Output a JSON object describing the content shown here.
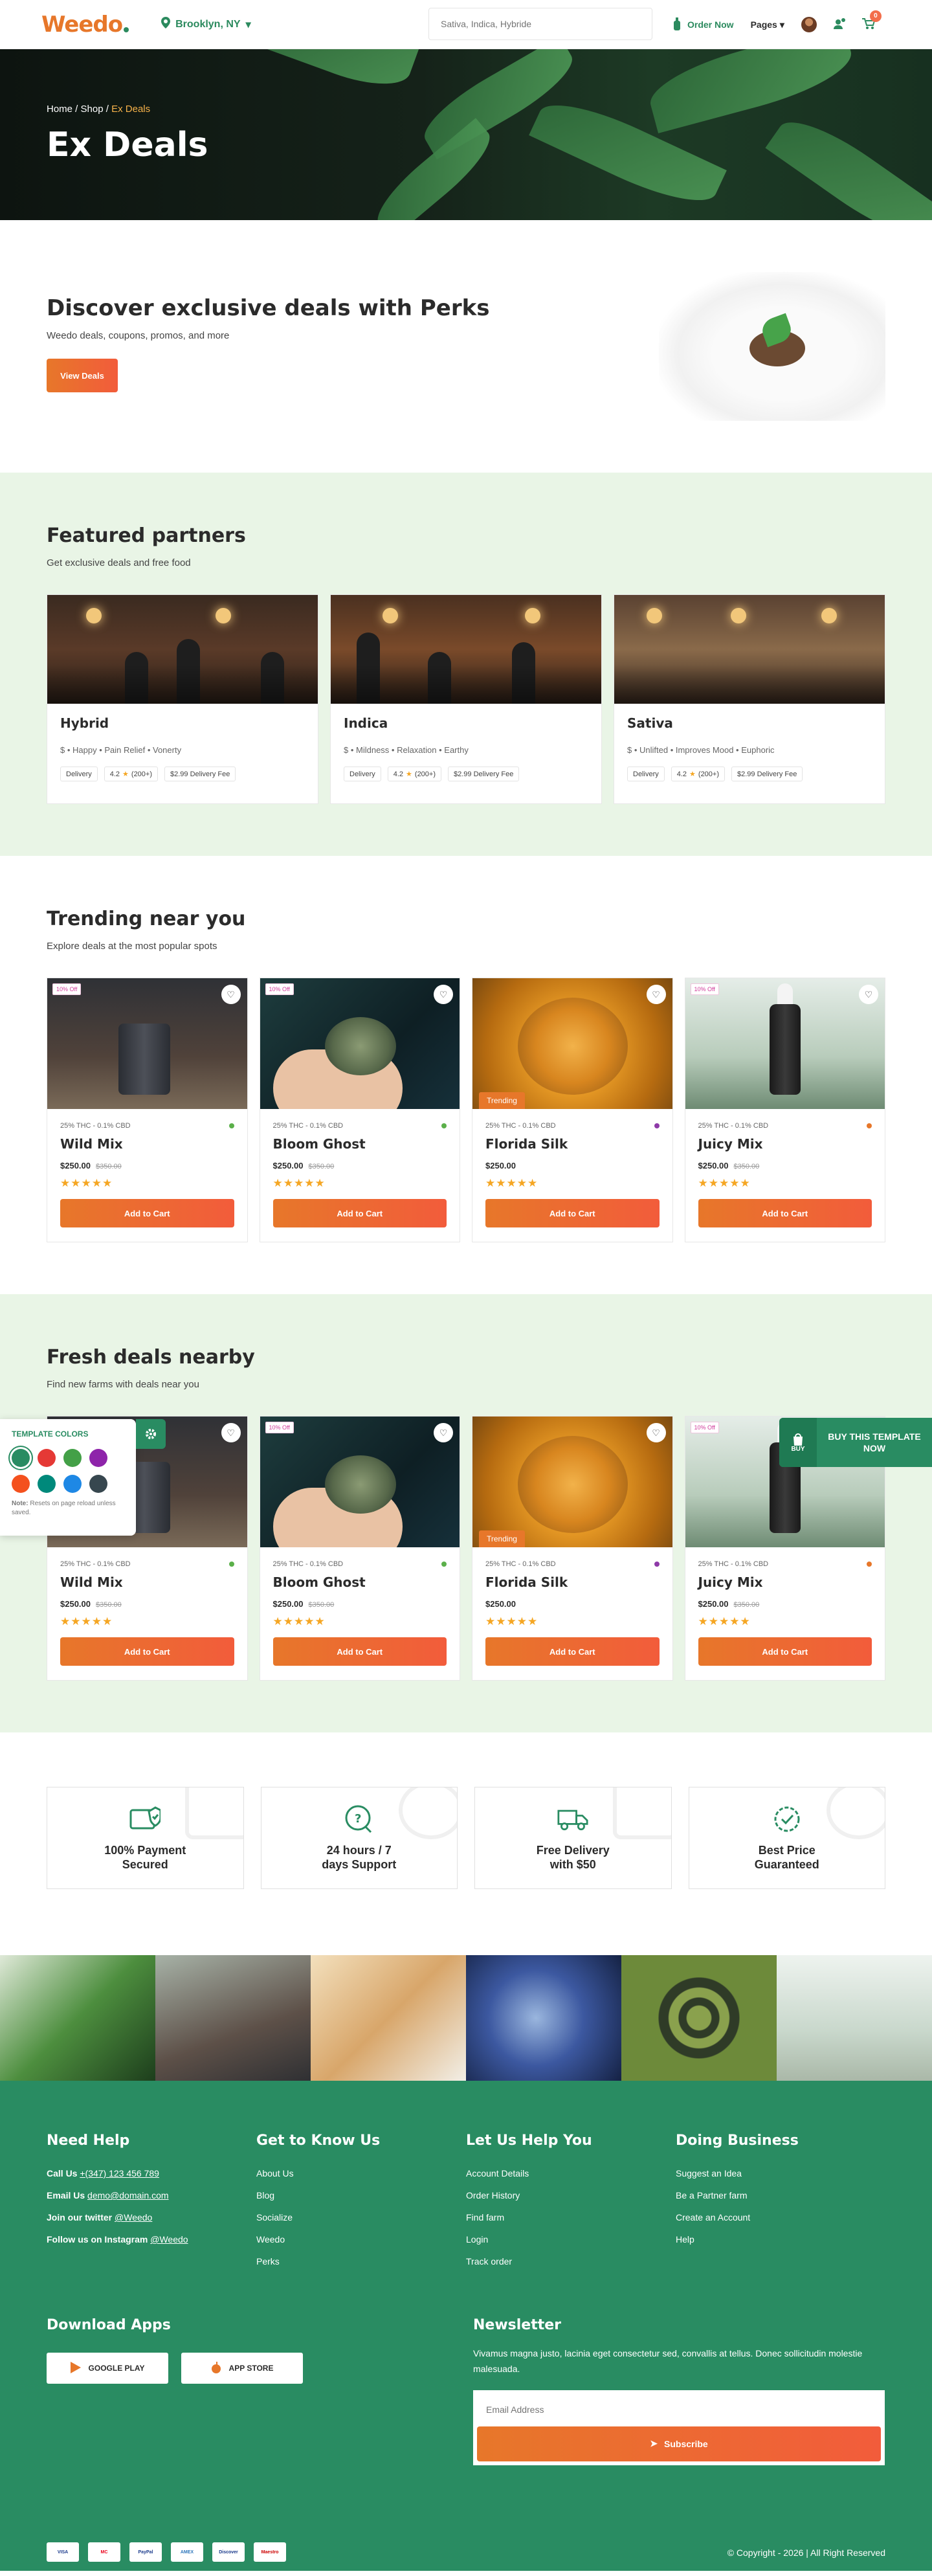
{
  "header": {
    "logo": "Weedo",
    "location": "Brooklyn, NY",
    "search_placeholder": "Sativa, Indica, Hybride",
    "order_now": "Order Now",
    "pages": "Pages",
    "cart_count": "0"
  },
  "hero": {
    "crumbs": [
      "Home",
      "Shop",
      "Ex Deals"
    ],
    "title": "Ex Deals"
  },
  "promo": {
    "title": "Discover exclusive deals with Perks",
    "subtitle": "Weedo deals, coupons, promos, and more",
    "button": "View Deals"
  },
  "featured": {
    "title": "Featured partners",
    "subtitle": "Get exclusive deals and free food",
    "cards": [
      {
        "name": "Hybrid",
        "tags": "$ • Happy • Pain Relief • Vonerty",
        "delivery": "Delivery",
        "rating": "4.2",
        "reviews": "(200+)",
        "fee": "$2.99 Delivery Fee"
      },
      {
        "name": "Indica",
        "tags": "$ • Mildness • Relaxation • Earthy",
        "delivery": "Delivery",
        "rating": "4.2",
        "reviews": "(200+)",
        "fee": "$2.99 Delivery Fee"
      },
      {
        "name": "Sativa",
        "tags": "$ • Unlifted • Improves Mood • Euphoric",
        "delivery": "Delivery",
        "rating": "4.2",
        "reviews": "(200+)",
        "fee": "$2.99 Delivery Fee"
      }
    ]
  },
  "trending": {
    "title": "Trending near you",
    "subtitle": "Explore deals at the most popular spots"
  },
  "fresh": {
    "title": "Fresh deals nearby",
    "subtitle": "Find new farms with deals near you"
  },
  "products": [
    {
      "badge": "10% Off",
      "trend": "",
      "thc": "25% THC - 0.1% CBD",
      "dot": "#5bb04a",
      "name": "Wild Mix",
      "price": "$250.00",
      "old": "$350.00",
      "button": "Add to Cart"
    },
    {
      "badge": "10% Off",
      "trend": "",
      "thc": "25% THC - 0.1% CBD",
      "dot": "#5bb04a",
      "name": "Bloom Ghost",
      "price": "$250.00",
      "old": "$350.00",
      "button": "Add to Cart"
    },
    {
      "badge": "",
      "trend": "Trending",
      "thc": "25% THC - 0.1% CBD",
      "dot": "#8e3aa8",
      "name": "Florida Silk",
      "price": "$250.00",
      "old": "",
      "button": "Add to Cart"
    },
    {
      "badge": "10% Off",
      "trend": "",
      "thc": "25% THC - 0.1% CBD",
      "dot": "#e7772a",
      "name": "Juicy Mix",
      "price": "$250.00",
      "old": "$350.00",
      "button": "Add to Cart"
    }
  ],
  "features": [
    "100% Payment Secured",
    "24 hours / 7 days Support",
    "Free Delivery with $50",
    "Best Price Guaranteed"
  ],
  "footer": {
    "help": {
      "title": "Need Help",
      "call_label": "Call Us",
      "call": "+(347) 123 456 789",
      "email_label": "Email Us",
      "email": "demo@domain.com",
      "twitter_label": "Join our twitter",
      "twitter": "@Weedo",
      "insta_label": "Follow us on Instagram",
      "insta": "@Weedo"
    },
    "know": {
      "title": "Get to Know Us",
      "items": [
        "About Us",
        "Blog",
        "Socialize",
        "Weedo",
        "Perks"
      ]
    },
    "helpyou": {
      "title": "Let Us Help You",
      "items": [
        "Account Details",
        "Order History",
        "Find farm",
        "Login",
        "Track order"
      ]
    },
    "business": {
      "title": "Doing Business",
      "items": [
        "Suggest an Idea",
        "Be a Partner farm",
        "Create an Account",
        "Help"
      ]
    },
    "apps": {
      "title": "Download Apps",
      "google": "GOOGLE PLAY",
      "apple": "APP STORE"
    },
    "newsletter": {
      "title": "Newsletter",
      "text": "Vivamus magna justo, lacinia eget consectetur sed, convallis at tellus. Donec sollicitudin molestie malesuada.",
      "placeholder": "Email Address",
      "button": "Subscribe"
    },
    "payments": [
      "VISA",
      "MC",
      "PayPal",
      "AMEX",
      "Discover",
      "Maestro"
    ],
    "copyright": "© Copyright - 2026 | All Right Reserved"
  },
  "template_colors": {
    "title": "TEMPLATE COLORS",
    "note_bold": "Note:",
    "note": "Resets on page reload unless saved.",
    "swatches": [
      "#298c62",
      "#e53935",
      "#43a047",
      "#8e24aa",
      "#f4511e",
      "#00897b",
      "#1e88e5",
      "#37474f"
    ]
  },
  "buy": {
    "icon_label": "BUY",
    "text": "BUY THIS TEMPLATE NOW"
  }
}
